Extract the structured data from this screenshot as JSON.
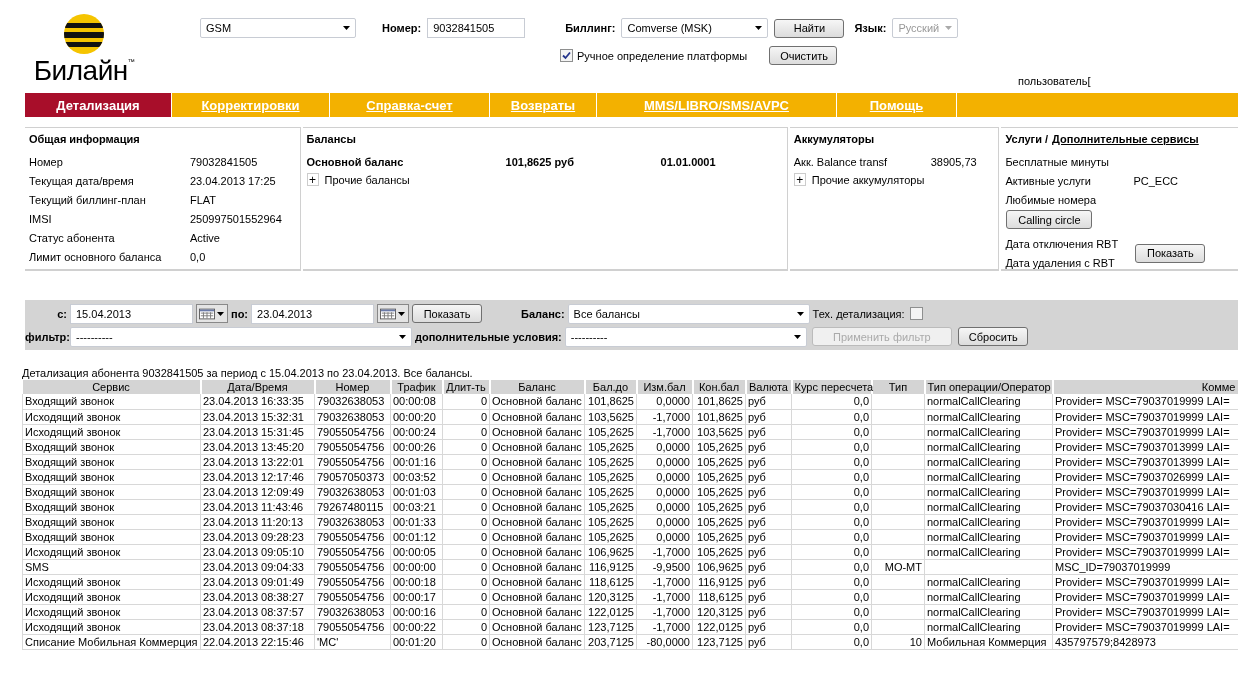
{
  "logo": {
    "text": "Билайн",
    "trademark": "™"
  },
  "header": {
    "platform_select": "GSM",
    "number_label": "Номер:",
    "number_value": "9032841505",
    "billing_label": "Биллинг:",
    "billing_select": "Comverse (MSK)",
    "find_button": "Найти",
    "language_label": "Язык:",
    "language_select": "Русский",
    "language_disabled": true,
    "manual_platform": {
      "label": "Ручное определение платформы",
      "checked": true
    },
    "clear_button": "Очистить",
    "user_label": "пользователь["
  },
  "nav_tabs": [
    {
      "label": "Детализация",
      "selected": true
    },
    {
      "label": "Корректировки",
      "selected": false
    },
    {
      "label": "Справка-счет",
      "selected": false
    },
    {
      "label": "Возвраты",
      "selected": false
    },
    {
      "label": "MMS/LIBRO/SMS/AVPC",
      "selected": false
    },
    {
      "label": "Помощь",
      "selected": false
    }
  ],
  "general_info": {
    "title": "Общая информация",
    "rows": [
      {
        "label": "Номер",
        "value": "79032841505"
      },
      {
        "label": "Текущая дата/время",
        "value": "23.04.2013 17:25"
      },
      {
        "label": "Текущий биллинг-план",
        "value": "FLAT"
      },
      {
        "label": "IMSI",
        "value": "250997501552964"
      },
      {
        "label": "Статус абонента",
        "value": "Active"
      },
      {
        "label": "Лимит основного баланса",
        "value": "0,0"
      }
    ]
  },
  "balances": {
    "title": "Балансы",
    "main": {
      "label": "Основной баланс",
      "amount": "101,8625 руб",
      "date": "01.01.0001"
    },
    "other": {
      "expander": "+",
      "label": "Прочие балансы"
    }
  },
  "accumulators": {
    "title": "Аккумуляторы",
    "rows": [
      {
        "label": "Акк. Balance transf",
        "value": "38905,73"
      }
    ],
    "other": {
      "expander": "+",
      "label": "Прочие аккумуляторы"
    }
  },
  "services": {
    "title": "Услуги /",
    "link": "Дополнительные сервисы",
    "free_minutes": "Бесплатные минуты",
    "active_label": "Активные услуги",
    "active_value": "PC_ECC",
    "favorites": "Любимые номера",
    "calling_circle_button": "Calling circle",
    "rbt_off": "Дата отключения RBT",
    "rbt_delete": "Дата удаления с RBT",
    "show_button": "Показать"
  },
  "filter": {
    "from_label": "с:",
    "from": "15.04.2013",
    "to_label": "по:",
    "to": "23.04.2013",
    "show_button": "Показать",
    "balance_label": "Баланс:",
    "balance_select": "Все балансы",
    "tech_label": "Тех. детализация:",
    "tech_checked": false,
    "filter_label": "фильтр:",
    "filter_select": "----------",
    "conditions_label": "дополнительные условия:",
    "conditions_select": "----------",
    "apply_button": {
      "label": "Применить фильтр",
      "disabled": true
    },
    "reset_button": "Сбросить"
  },
  "caption": "Детализация абонента 9032841505 за период с 15.04.2013 по 23.04.2013. Все балансы.",
  "table": {
    "columns": [
      "Сервис",
      "Дата/Время",
      "Номер",
      "Трафик",
      "Длит-ть",
      "Баланс",
      "Бал.до",
      "Изм.бал",
      "Кон.бал",
      "Валюта",
      "Курс пересчета",
      "Тип",
      "Тип операции/Оператор",
      "Комме"
    ],
    "rows": [
      {
        "service": "Входящий звонок",
        "datetime": "23.04.2013 16:33:35",
        "number": "79032638053",
        "traffic": "00:00:08",
        "duration": "0",
        "balance": "Основной баланс",
        "bal_before": "101,8625",
        "change": "0,0000",
        "bal_after": "101,8625",
        "currency": "руб",
        "rate": "0,0",
        "operation": "normalCallClearing",
        "comment": "Provider= MSC=79037019999 LAI="
      },
      {
        "service": "Исходящий звонок",
        "datetime": "23.04.2013 15:32:31",
        "number": "79032638053",
        "traffic": "00:00:20",
        "duration": "0",
        "balance": "Основной баланс",
        "bal_before": "103,5625",
        "change": "-1,7000",
        "bal_after": "101,8625",
        "currency": "руб",
        "rate": "0,0",
        "operation": "normalCallClearing",
        "comment": "Provider= MSC=79037019999 LAI="
      },
      {
        "service": "Исходящий звонок",
        "datetime": "23.04.2013 15:31:45",
        "number": "79055054756",
        "traffic": "00:00:24",
        "duration": "0",
        "balance": "Основной баланс",
        "bal_before": "105,2625",
        "change": "-1,7000",
        "bal_after": "103,5625",
        "currency": "руб",
        "rate": "0,0",
        "operation": "normalCallClearing",
        "comment": "Provider= MSC=79037019999 LAI="
      },
      {
        "service": "Входящий звонок",
        "datetime": "23.04.2013 13:45:20",
        "number": "79055054756",
        "traffic": "00:00:26",
        "duration": "0",
        "balance": "Основной баланс",
        "bal_before": "105,2625",
        "change": "0,0000",
        "bal_after": "105,2625",
        "currency": "руб",
        "rate": "0,0",
        "operation": "normalCallClearing",
        "comment": "Provider= MSC=79037013999 LAI="
      },
      {
        "service": "Входящий звонок",
        "datetime": "23.04.2013 13:22:01",
        "number": "79055054756",
        "traffic": "00:01:16",
        "duration": "0",
        "balance": "Основной баланс",
        "bal_before": "105,2625",
        "change": "0,0000",
        "bal_after": "105,2625",
        "currency": "руб",
        "rate": "0,0",
        "operation": "normalCallClearing",
        "comment": "Provider= MSC=79037013999 LAI="
      },
      {
        "service": "Входящий звонок",
        "datetime": "23.04.2013 12:17:46",
        "number": "79057050373",
        "traffic": "00:03:52",
        "duration": "0",
        "balance": "Основной баланс",
        "bal_before": "105,2625",
        "change": "0,0000",
        "bal_after": "105,2625",
        "currency": "руб",
        "rate": "0,0",
        "operation": "normalCallClearing",
        "comment": "Provider= MSC=79037026999 LAI="
      },
      {
        "service": "Входящий звонок",
        "datetime": "23.04.2013 12:09:49",
        "number": "79032638053",
        "traffic": "00:01:03",
        "duration": "0",
        "balance": "Основной баланс",
        "bal_before": "105,2625",
        "change": "0,0000",
        "bal_after": "105,2625",
        "currency": "руб",
        "rate": "0,0",
        "operation": "normalCallClearing",
        "comment": "Provider= MSC=79037019999 LAI="
      },
      {
        "service": "Входящий звонок",
        "datetime": "23.04.2013 11:43:46",
        "number": "79267480115",
        "traffic": "00:03:21",
        "duration": "0",
        "balance": "Основной баланс",
        "bal_before": "105,2625",
        "change": "0,0000",
        "bal_after": "105,2625",
        "currency": "руб",
        "rate": "0,0",
        "operation": "normalCallClearing",
        "comment": "Provider= MSC=79037030416 LAI="
      },
      {
        "service": "Входящий звонок",
        "datetime": "23.04.2013 11:20:13",
        "number": "79032638053",
        "traffic": "00:01:33",
        "duration": "0",
        "balance": "Основной баланс",
        "bal_before": "105,2625",
        "change": "0,0000",
        "bal_after": "105,2625",
        "currency": "руб",
        "rate": "0,0",
        "operation": "normalCallClearing",
        "comment": "Provider= MSC=79037019999 LAI="
      },
      {
        "service": "Входящий звонок",
        "datetime": "23.04.2013 09:28:23",
        "number": "79055054756",
        "traffic": "00:01:12",
        "duration": "0",
        "balance": "Основной баланс",
        "bal_before": "105,2625",
        "change": "0,0000",
        "bal_after": "105,2625",
        "currency": "руб",
        "rate": "0,0",
        "operation": "normalCallClearing",
        "comment": "Provider= MSC=79037019999 LAI="
      },
      {
        "service": "Исходящий звонок",
        "datetime": "23.04.2013 09:05:10",
        "number": "79055054756",
        "traffic": "00:00:05",
        "duration": "0",
        "balance": "Основной баланс",
        "bal_before": "106,9625",
        "change": "-1,7000",
        "bal_after": "105,2625",
        "currency": "руб",
        "rate": "0,0",
        "operation": "normalCallClearing",
        "comment": "Provider= MSC=79037019999 LAI="
      },
      {
        "service": "SMS",
        "datetime": "23.04.2013 09:04:33",
        "number": "79055054756",
        "traffic": "00:00:00",
        "duration": "0",
        "balance": "Основной баланс",
        "bal_before": "116,9125",
        "change": "-9,9500",
        "bal_after": "106,9625",
        "currency": "руб",
        "rate": "0,0",
        "type": "МО-МТ",
        "comment": "MSC_ID=79037019999"
      },
      {
        "service": "Исходящий звонок",
        "datetime": "23.04.2013 09:01:49",
        "number": "79055054756",
        "traffic": "00:00:18",
        "duration": "0",
        "balance": "Основной баланс",
        "bal_before": "118,6125",
        "change": "-1,7000",
        "bal_after": "116,9125",
        "currency": "руб",
        "rate": "0,0",
        "operation": "normalCallClearing",
        "comment": "Provider= MSC=79037019999 LAI="
      },
      {
        "service": "Исходящий звонок",
        "datetime": "23.04.2013 08:38:27",
        "number": "79055054756",
        "traffic": "00:00:17",
        "duration": "0",
        "balance": "Основной баланс",
        "bal_before": "120,3125",
        "change": "-1,7000",
        "bal_after": "118,6125",
        "currency": "руб",
        "rate": "0,0",
        "operation": "normalCallClearing",
        "comment": "Provider= MSC=79037019999 LAI="
      },
      {
        "service": "Исходящий звонок",
        "datetime": "23.04.2013 08:37:57",
        "number": "79032638053",
        "traffic": "00:00:16",
        "duration": "0",
        "balance": "Основной баланс",
        "bal_before": "122,0125",
        "change": "-1,7000",
        "bal_after": "120,3125",
        "currency": "руб",
        "rate": "0,0",
        "operation": "normalCallClearing",
        "comment": "Provider= MSC=79037019999 LAI="
      },
      {
        "service": "Исходящий звонок",
        "datetime": "23.04.2013 08:37:18",
        "number": "79055054756",
        "traffic": "00:00:22",
        "duration": "0",
        "balance": "Основной баланс",
        "bal_before": "123,7125",
        "change": "-1,7000",
        "bal_after": "122,0125",
        "currency": "руб",
        "rate": "0,0",
        "operation": "normalCallClearing",
        "comment": "Provider= MSC=79037019999 LAI="
      },
      {
        "service": "Списание Мобильная Коммерция",
        "datetime": "22.04.2013 22:15:46",
        "number": "'MC'",
        "traffic": "00:01:20",
        "duration": "0",
        "balance": "Основной баланс",
        "bal_before": "203,7125",
        "change": "-80,0000",
        "bal_after": "123,7125",
        "currency": "руб",
        "rate": "0,0",
        "type": "10",
        "operation": "Мобильная Коммерция",
        "comment": "435797579;8428973"
      }
    ]
  }
}
